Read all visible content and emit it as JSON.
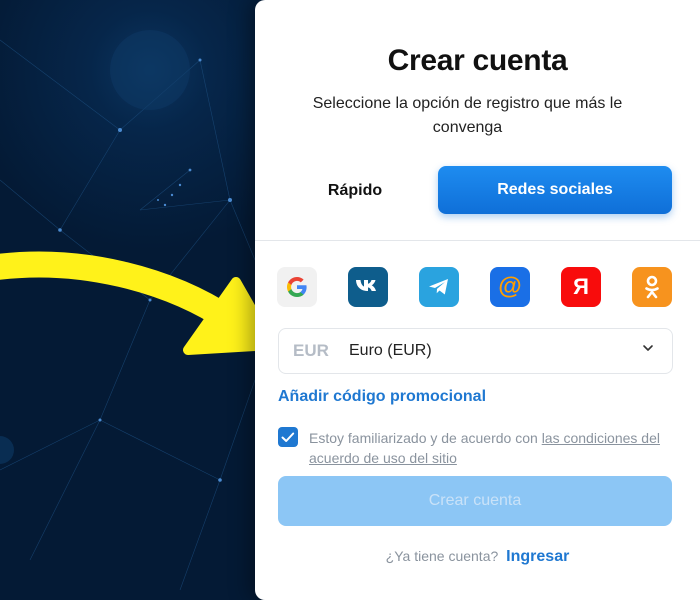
{
  "signup": {
    "title": "Crear cuenta",
    "subtitle": "Seleccione la opción de registro que más le convenga",
    "tabs": {
      "quick": "Rápido",
      "social": "Redes sociales",
      "active": "social"
    },
    "social_providers": [
      {
        "name": "Google",
        "icon": "google-icon",
        "color": "#f1f1f1"
      },
      {
        "name": "VK",
        "icon": "vk-icon",
        "color": "#0e5d8c"
      },
      {
        "name": "Telegram",
        "icon": "telegram-icon",
        "color": "#2aa3df"
      },
      {
        "name": "Mail.ru",
        "icon": "mail-at-icon",
        "color": "#1a6fe6"
      },
      {
        "name": "Yandex",
        "icon": "yandex-icon",
        "color": "#f80c0c"
      },
      {
        "name": "Odnoklassniki",
        "icon": "odnoklassniki-icon",
        "color": "#f7931e"
      }
    ],
    "currency": {
      "code": "EUR",
      "name": "Euro (EUR)"
    },
    "promo_link": "Añadir código promocional",
    "agreement": {
      "checked": true,
      "text": "Estoy familiarizado y de acuerdo con ",
      "link": "las condiciones del acuerdo de uso del sitio"
    },
    "submit_label": "Crear cuenta",
    "login_prompt": "¿Ya tiene cuenta?",
    "login_link": "Ingresar"
  },
  "colors": {
    "accent": "#1f78d1",
    "tab_active": "#0f6fd8",
    "submit_disabled": "#8cc6f5",
    "annotation_arrow": "#fff21a"
  }
}
